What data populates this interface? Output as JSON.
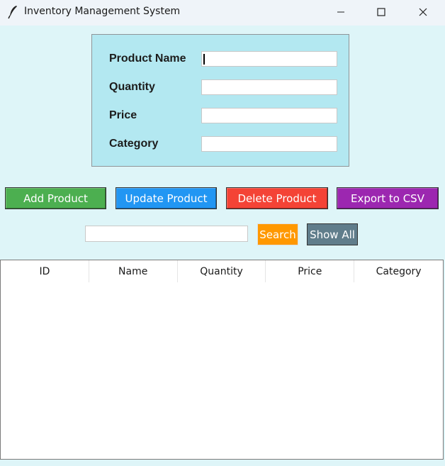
{
  "window": {
    "title": "Inventory Management System",
    "icon": "feather-icon"
  },
  "form": {
    "fields": [
      {
        "label": "Product Name",
        "value": ""
      },
      {
        "label": "Quantity",
        "value": ""
      },
      {
        "label": "Price",
        "value": ""
      },
      {
        "label": "Category",
        "value": ""
      }
    ]
  },
  "actions": {
    "add": {
      "label": "Add Product",
      "color": "#4caf50"
    },
    "update": {
      "label": "Update Product",
      "color": "#2196f3"
    },
    "delete": {
      "label": "Delete Product",
      "color": "#f44336"
    },
    "export": {
      "label": "Export to CSV",
      "color": "#9c27b0"
    }
  },
  "search": {
    "value": "",
    "search_label": "Search",
    "search_color": "#ff9800",
    "show_all_label": "Show All",
    "show_all_color": "#607d8b"
  },
  "table": {
    "columns": [
      "ID",
      "Name",
      "Quantity",
      "Price",
      "Category"
    ],
    "rows": []
  },
  "colors": {
    "window_background": "#def5f8",
    "form_background": "#b3e8f1"
  }
}
